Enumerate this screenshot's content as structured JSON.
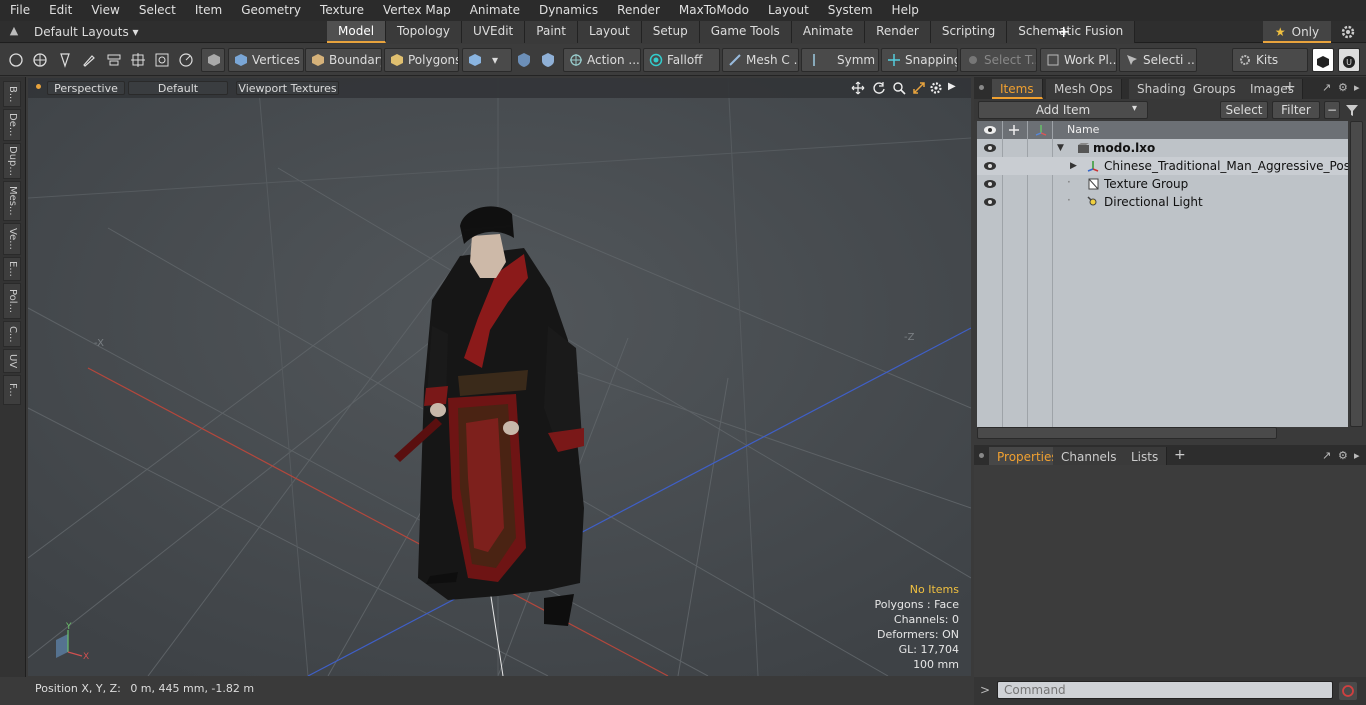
{
  "menu": [
    "File",
    "Edit",
    "View",
    "Select",
    "Item",
    "Geometry",
    "Texture",
    "Vertex Map",
    "Animate",
    "Dynamics",
    "Render",
    "MaxToModo",
    "Layout",
    "System",
    "Help"
  ],
  "layouts_label": "Default Layouts ▾",
  "tabs": [
    "Model",
    "Topology",
    "UVEdit",
    "Paint",
    "Layout",
    "Setup",
    "Game Tools",
    "Animate",
    "Render",
    "Scripting",
    "Schematic Fusion"
  ],
  "active_tab": "Model",
  "only_label": "Only",
  "toolbar": {
    "vertices": "Vertices",
    "boundary": "Boundary",
    "polygons": "Polygons",
    "action": "Action",
    "action_more": "...",
    "falloff": "Falloff",
    "mesh_c": "Mesh C ...",
    "symm": "Symm ...",
    "snapping": "Snapping",
    "select_t": "Select T...",
    "work_pl": "Work Pl...",
    "selecti": "Selecti ...",
    "kits": "Kits"
  },
  "left_tabs": [
    "B...",
    "De...",
    "Dup...",
    "Mes...",
    "Ve...",
    "E...",
    "Pol...",
    "C...",
    "UV",
    "F..."
  ],
  "viewport": {
    "view_mode": "Perspective",
    "shading": "Default",
    "textures": "Viewport Textures",
    "stats": {
      "items": "No Items",
      "polygons": "Polygons : Face",
      "channels": "Channels: 0",
      "deformers": "Deformers: ON",
      "gl": "GL: 17,704",
      "scale": "100 mm"
    }
  },
  "status": {
    "label": "Position X, Y, Z:",
    "value": "0 m, 445 mm, -1.82 m"
  },
  "items_panel": {
    "tabs": [
      "Items",
      "Mesh Ops",
      "Shading",
      "Groups",
      "Images"
    ],
    "add_item": "Add Item",
    "select": "Select",
    "filter": "Filter",
    "column_name": "Name",
    "tree": [
      {
        "label": "modo.lxo",
        "bold": true,
        "icon": "scene-icon"
      },
      {
        "label": "Chinese_Traditional_Man_Aggressive_Pose",
        "bold": false,
        "icon": "mesh-icon"
      },
      {
        "label": "Texture Group",
        "bold": false,
        "icon": "texture-group-icon"
      },
      {
        "label": "Directional Light",
        "bold": false,
        "icon": "light-icon"
      }
    ]
  },
  "properties_panel": {
    "tabs": [
      "Properties",
      "Channels",
      "Lists"
    ]
  },
  "command": {
    "placeholder": "Command"
  },
  "colors": {
    "accent": "#e8a33d",
    "viewport_bg": "#4a4e52",
    "tree_bg": "#bec3c8",
    "stats_warn": "#f0c040"
  }
}
